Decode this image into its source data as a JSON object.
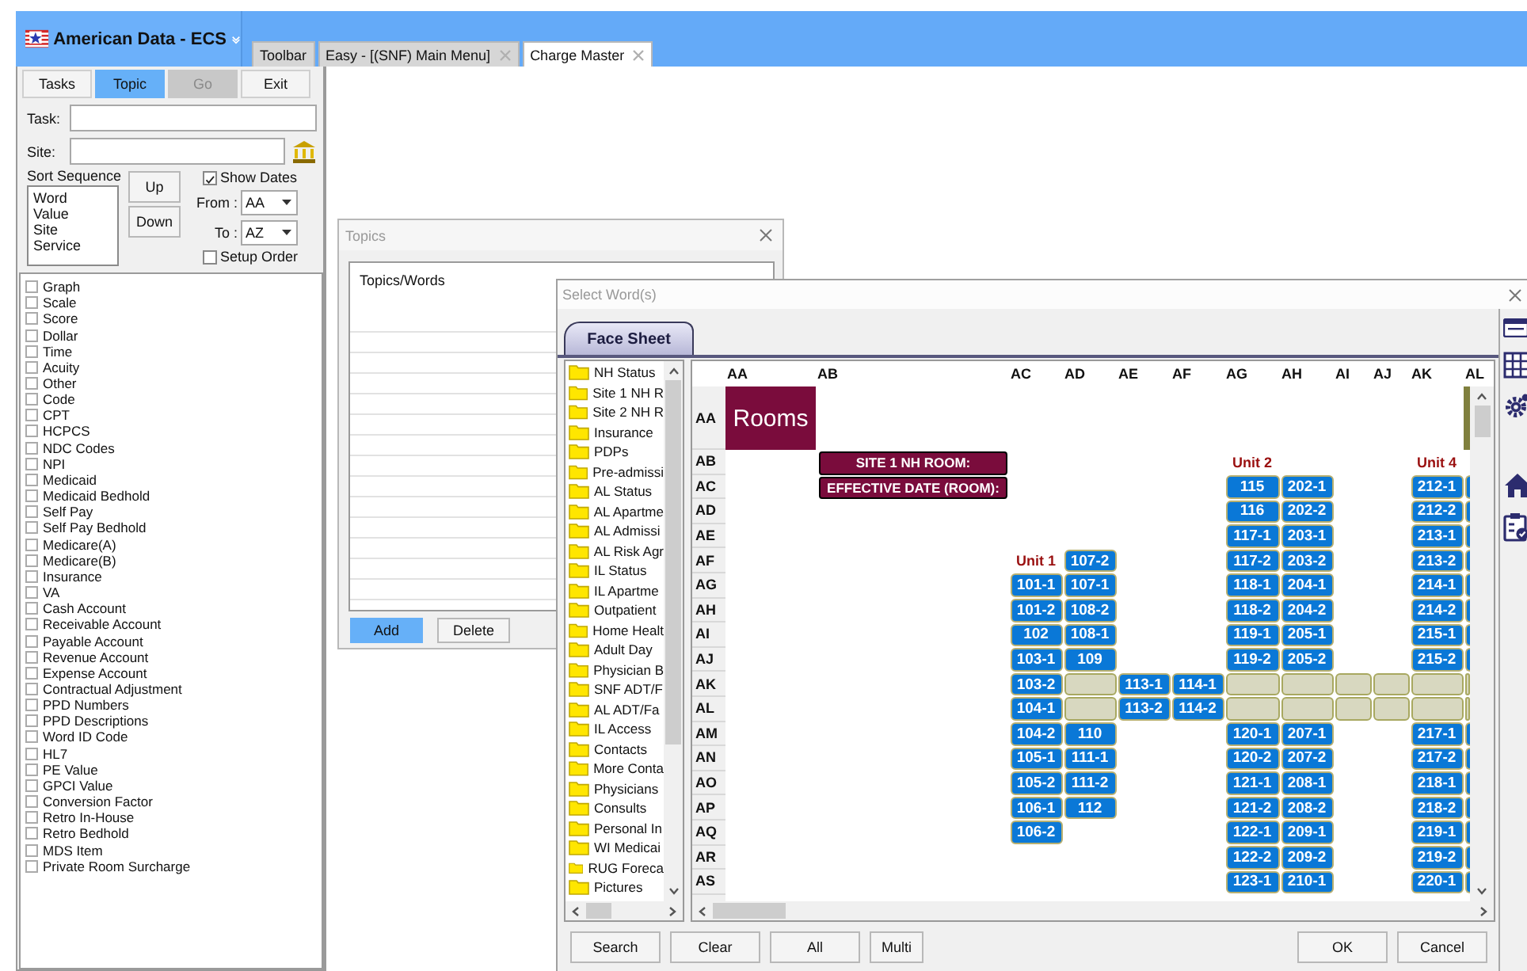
{
  "app": {
    "title": "American Data - ECS"
  },
  "tabs": [
    {
      "label": "Toolbar",
      "selected": false,
      "closable": false
    },
    {
      "label": "Easy - [(SNF) Main Menu]",
      "selected": false,
      "closable": true
    },
    {
      "label": "Charge Master",
      "selected": true,
      "closable": true
    }
  ],
  "side_panel": {
    "buttons": [
      {
        "label": "Tasks",
        "selected": false,
        "disabled": false
      },
      {
        "label": "Topic",
        "selected": true,
        "disabled": false
      },
      {
        "label": "Go",
        "selected": false,
        "disabled": true
      },
      {
        "label": "Exit",
        "selected": false,
        "disabled": false
      }
    ],
    "task": {
      "label": "Task:"
    },
    "site": {
      "label": "Site:"
    },
    "sort_sequence": {
      "label": "Sort Sequence",
      "items": [
        "Word",
        "Value",
        "Site",
        "Service"
      ]
    },
    "up_button": "Up",
    "down_button": "Down",
    "show_dates": {
      "label": "Show Dates",
      "checked": true
    },
    "from": {
      "label": "From :",
      "value": "AA"
    },
    "to": {
      "label": "To :",
      "value": "AZ"
    },
    "setup_order": {
      "label": "Setup Order",
      "checked": false
    },
    "categories": [
      {
        "label": "Graph",
        "checked": false
      },
      {
        "label": "Scale",
        "checked": false
      },
      {
        "label": "Score",
        "checked": false
      },
      {
        "label": "Dollar",
        "checked": false
      },
      {
        "label": "Time",
        "checked": false
      },
      {
        "label": "Acuity",
        "checked": false
      },
      {
        "label": "Other",
        "checked": false
      },
      {
        "label": "Code",
        "checked": false
      },
      {
        "label": "CPT",
        "checked": false
      },
      {
        "label": "HCPCS",
        "checked": false
      },
      {
        "label": "NDC Codes",
        "checked": false
      },
      {
        "label": "NPI",
        "checked": false
      },
      {
        "label": "Medicaid",
        "checked": false
      },
      {
        "label": "Medicaid Bedhold",
        "checked": false
      },
      {
        "label": "Self Pay",
        "checked": false
      },
      {
        "label": "Self Pay Bedhold",
        "checked": false
      },
      {
        "label": "Medicare(A)",
        "checked": false
      },
      {
        "label": "Medicare(B)",
        "checked": false
      },
      {
        "label": "Insurance",
        "checked": false
      },
      {
        "label": "VA",
        "checked": false
      },
      {
        "label": "Cash Account",
        "checked": false
      },
      {
        "label": "Receivable Account",
        "checked": false
      },
      {
        "label": "Payable Account",
        "checked": false
      },
      {
        "label": "Revenue Account",
        "checked": false
      },
      {
        "label": "Expense Account",
        "checked": false
      },
      {
        "label": "Contractual Adjustment",
        "checked": false
      },
      {
        "label": "PPD Numbers",
        "checked": false
      },
      {
        "label": "PPD Descriptions",
        "checked": false
      },
      {
        "label": "Word ID Code",
        "checked": false
      },
      {
        "label": "HL7",
        "checked": false
      },
      {
        "label": "PE Value",
        "checked": false
      },
      {
        "label": "GPCI Value",
        "checked": false
      },
      {
        "label": "Conversion Factor",
        "checked": false
      },
      {
        "label": "Retro In-House",
        "checked": false
      },
      {
        "label": "Retro Bedhold",
        "checked": false
      },
      {
        "label": "MDS Item",
        "checked": false
      },
      {
        "label": "Private Room Surcharge",
        "checked": false
      }
    ]
  },
  "topics_dialog": {
    "title": "Topics",
    "column": "Topics/Words",
    "buttons": [
      {
        "label": "Add",
        "selected": true
      },
      {
        "label": "Delete",
        "selected": false
      }
    ]
  },
  "select_words": {
    "title": "Select Word(s)",
    "tabs": [
      {
        "label": "Face Sheet",
        "selected": true
      }
    ],
    "folders": [
      "NH Status",
      "Site 1 NH R",
      "Site 2 NH R",
      "Insurance",
      "PDPs",
      "Pre-admissi",
      "AL Status",
      "AL Apartme",
      "AL Admissi",
      "AL Risk Agr",
      "IL Status",
      "IL Apartme",
      "Outpatient",
      "Home Healt",
      "Adult Day",
      "Physician B",
      "SNF ADT/F",
      "AL ADT/Fa",
      "IL Access",
      "Contacts",
      "More Conta",
      "Physicians",
      "Consults",
      "Personal In",
      "WI Medicai",
      "RUG Foreca",
      "Pictures"
    ],
    "grid": {
      "columns": [
        "AA",
        "AB",
        "AC",
        "AD",
        "AE",
        "AF",
        "AG",
        "AH",
        "AI",
        "AJ",
        "AK",
        "AL"
      ],
      "rows": [
        {
          "label": "AA",
          "cells": [
            {
              "kind": "title",
              "text": "Rooms"
            },
            {
              "kind": "banner"
            }
          ]
        },
        {
          "label": "AB",
          "cells": [
            {
              "kind": "empty"
            },
            {
              "kind": "field",
              "text": "SITE 1 NH ROOM:"
            },
            {
              "kind": "empty"
            },
            {
              "kind": "empty"
            },
            {
              "kind": "empty"
            },
            {
              "kind": "empty"
            },
            {
              "kind": "unit",
              "text": "Unit 2"
            },
            {
              "kind": "empty"
            },
            {
              "kind": "empty"
            },
            {
              "kind": "empty"
            },
            {
              "kind": "unit",
              "text": "Unit 4"
            }
          ]
        },
        {
          "label": "AC",
          "cells": [
            {
              "kind": "empty"
            },
            {
              "kind": "field",
              "text": "EFFECTIVE DATE (ROOM):"
            },
            {
              "kind": "empty"
            },
            {
              "kind": "empty"
            },
            {
              "kind": "empty"
            },
            {
              "kind": "empty"
            },
            {
              "kind": "room",
              "text": "115"
            },
            {
              "kind": "room",
              "text": "202-1"
            },
            {
              "kind": "empty"
            },
            {
              "kind": "empty"
            },
            {
              "kind": "room",
              "text": "212-1"
            },
            {
              "kind": "edge"
            }
          ]
        },
        {
          "label": "AD",
          "cells": [
            {
              "kind": "empty"
            },
            {
              "kind": "empty"
            },
            {
              "kind": "empty"
            },
            {
              "kind": "empty"
            },
            {
              "kind": "empty"
            },
            {
              "kind": "empty"
            },
            {
              "kind": "room",
              "text": "116"
            },
            {
              "kind": "room",
              "text": "202-2"
            },
            {
              "kind": "empty"
            },
            {
              "kind": "empty"
            },
            {
              "kind": "room",
              "text": "212-2"
            },
            {
              "kind": "edge"
            }
          ]
        },
        {
          "label": "AE",
          "cells": [
            {
              "kind": "empty"
            },
            {
              "kind": "empty"
            },
            {
              "kind": "empty"
            },
            {
              "kind": "empty"
            },
            {
              "kind": "empty"
            },
            {
              "kind": "empty"
            },
            {
              "kind": "room",
              "text": "117-1"
            },
            {
              "kind": "room",
              "text": "203-1"
            },
            {
              "kind": "empty"
            },
            {
              "kind": "empty"
            },
            {
              "kind": "room",
              "text": "213-1"
            },
            {
              "kind": "edge"
            }
          ]
        },
        {
          "label": "AF",
          "cells": [
            {
              "kind": "empty"
            },
            {
              "kind": "empty"
            },
            {
              "kind": "unit",
              "text": "Unit 1"
            },
            {
              "kind": "room",
              "text": "107-2"
            },
            {
              "kind": "empty"
            },
            {
              "kind": "empty"
            },
            {
              "kind": "room",
              "text": "117-2"
            },
            {
              "kind": "room",
              "text": "203-2"
            },
            {
              "kind": "empty"
            },
            {
              "kind": "empty"
            },
            {
              "kind": "room",
              "text": "213-2"
            },
            {
              "kind": "edge"
            }
          ]
        },
        {
          "label": "AG",
          "cells": [
            {
              "kind": "empty"
            },
            {
              "kind": "empty"
            },
            {
              "kind": "room",
              "text": "101-1"
            },
            {
              "kind": "room",
              "text": "107-1"
            },
            {
              "kind": "empty"
            },
            {
              "kind": "empty"
            },
            {
              "kind": "room",
              "text": "118-1"
            },
            {
              "kind": "room",
              "text": "204-1"
            },
            {
              "kind": "empty"
            },
            {
              "kind": "empty"
            },
            {
              "kind": "room",
              "text": "214-1"
            },
            {
              "kind": "edge"
            }
          ]
        },
        {
          "label": "AH",
          "cells": [
            {
              "kind": "empty"
            },
            {
              "kind": "empty"
            },
            {
              "kind": "room",
              "text": "101-2"
            },
            {
              "kind": "room",
              "text": "108-2"
            },
            {
              "kind": "empty"
            },
            {
              "kind": "empty"
            },
            {
              "kind": "room",
              "text": "118-2"
            },
            {
              "kind": "room",
              "text": "204-2"
            },
            {
              "kind": "empty"
            },
            {
              "kind": "empty"
            },
            {
              "kind": "room",
              "text": "214-2"
            },
            {
              "kind": "edge"
            }
          ]
        },
        {
          "label": "AI",
          "cells": [
            {
              "kind": "empty"
            },
            {
              "kind": "empty"
            },
            {
              "kind": "room",
              "text": "102"
            },
            {
              "kind": "room",
              "text": "108-1"
            },
            {
              "kind": "empty"
            },
            {
              "kind": "empty"
            },
            {
              "kind": "room",
              "text": "119-1"
            },
            {
              "kind": "room",
              "text": "205-1"
            },
            {
              "kind": "empty"
            },
            {
              "kind": "empty"
            },
            {
              "kind": "room",
              "text": "215-1"
            },
            {
              "kind": "edge"
            }
          ]
        },
        {
          "label": "AJ",
          "cells": [
            {
              "kind": "empty"
            },
            {
              "kind": "empty"
            },
            {
              "kind": "room",
              "text": "103-1"
            },
            {
              "kind": "room",
              "text": "109"
            },
            {
              "kind": "empty"
            },
            {
              "kind": "empty"
            },
            {
              "kind": "room",
              "text": "119-2"
            },
            {
              "kind": "room",
              "text": "205-2"
            },
            {
              "kind": "empty"
            },
            {
              "kind": "empty"
            },
            {
              "kind": "room",
              "text": "215-2"
            },
            {
              "kind": "edge"
            }
          ]
        },
        {
          "label": "AK",
          "cells": [
            {
              "kind": "empty"
            },
            {
              "kind": "empty"
            },
            {
              "kind": "room",
              "text": "103-2"
            },
            {
              "kind": "corridor"
            },
            {
              "kind": "room",
              "text": "113-1"
            },
            {
              "kind": "room",
              "text": "114-1"
            },
            {
              "kind": "corridor"
            },
            {
              "kind": "corridor"
            },
            {
              "kind": "corridor"
            },
            {
              "kind": "corridor"
            },
            {
              "kind": "corridor"
            },
            {
              "kind": "corridor"
            }
          ]
        },
        {
          "label": "AL",
          "cells": [
            {
              "kind": "empty"
            },
            {
              "kind": "empty"
            },
            {
              "kind": "room",
              "text": "104-1"
            },
            {
              "kind": "corridor"
            },
            {
              "kind": "room",
              "text": "113-2"
            },
            {
              "kind": "room",
              "text": "114-2"
            },
            {
              "kind": "corridor"
            },
            {
              "kind": "corridor"
            },
            {
              "kind": "corridor"
            },
            {
              "kind": "corridor"
            },
            {
              "kind": "corridor"
            },
            {
              "kind": "corridor"
            }
          ]
        },
        {
          "label": "AM",
          "cells": [
            {
              "kind": "empty"
            },
            {
              "kind": "empty"
            },
            {
              "kind": "room",
              "text": "104-2"
            },
            {
              "kind": "room",
              "text": "110"
            },
            {
              "kind": "empty"
            },
            {
              "kind": "empty"
            },
            {
              "kind": "room",
              "text": "120-1"
            },
            {
              "kind": "room",
              "text": "207-1"
            },
            {
              "kind": "empty"
            },
            {
              "kind": "empty"
            },
            {
              "kind": "room",
              "text": "217-1"
            },
            {
              "kind": "edge"
            }
          ]
        },
        {
          "label": "AN",
          "cells": [
            {
              "kind": "empty"
            },
            {
              "kind": "empty"
            },
            {
              "kind": "room",
              "text": "105-1"
            },
            {
              "kind": "room",
              "text": "111-1"
            },
            {
              "kind": "empty"
            },
            {
              "kind": "empty"
            },
            {
              "kind": "room",
              "text": "120-2"
            },
            {
              "kind": "room",
              "text": "207-2"
            },
            {
              "kind": "empty"
            },
            {
              "kind": "empty"
            },
            {
              "kind": "room",
              "text": "217-2"
            },
            {
              "kind": "edge"
            }
          ]
        },
        {
          "label": "AO",
          "cells": [
            {
              "kind": "empty"
            },
            {
              "kind": "empty"
            },
            {
              "kind": "room",
              "text": "105-2"
            },
            {
              "kind": "room",
              "text": "111-2"
            },
            {
              "kind": "empty"
            },
            {
              "kind": "empty"
            },
            {
              "kind": "room",
              "text": "121-1"
            },
            {
              "kind": "room",
              "text": "208-1"
            },
            {
              "kind": "empty"
            },
            {
              "kind": "empty"
            },
            {
              "kind": "room",
              "text": "218-1"
            },
            {
              "kind": "edge"
            }
          ]
        },
        {
          "label": "AP",
          "cells": [
            {
              "kind": "empty"
            },
            {
              "kind": "empty"
            },
            {
              "kind": "room",
              "text": "106-1"
            },
            {
              "kind": "room",
              "text": "112"
            },
            {
              "kind": "empty"
            },
            {
              "kind": "empty"
            },
            {
              "kind": "room",
              "text": "121-2"
            },
            {
              "kind": "room",
              "text": "208-2"
            },
            {
              "kind": "empty"
            },
            {
              "kind": "empty"
            },
            {
              "kind": "room",
              "text": "218-2"
            },
            {
              "kind": "edge"
            }
          ]
        },
        {
          "label": "AQ",
          "cells": [
            {
              "kind": "empty"
            },
            {
              "kind": "empty"
            },
            {
              "kind": "room",
              "text": "106-2"
            },
            {
              "kind": "empty"
            },
            {
              "kind": "empty"
            },
            {
              "kind": "empty"
            },
            {
              "kind": "room",
              "text": "122-1"
            },
            {
              "kind": "room",
              "text": "209-1"
            },
            {
              "kind": "empty"
            },
            {
              "kind": "empty"
            },
            {
              "kind": "room",
              "text": "219-1"
            },
            {
              "kind": "edge"
            }
          ]
        },
        {
          "label": "AR",
          "cells": [
            {
              "kind": "empty"
            },
            {
              "kind": "empty"
            },
            {
              "kind": "empty"
            },
            {
              "kind": "empty"
            },
            {
              "kind": "empty"
            },
            {
              "kind": "empty"
            },
            {
              "kind": "room",
              "text": "122-2"
            },
            {
              "kind": "room",
              "text": "209-2"
            },
            {
              "kind": "empty"
            },
            {
              "kind": "empty"
            },
            {
              "kind": "room",
              "text": "219-2"
            },
            {
              "kind": "edge"
            }
          ]
        },
        {
          "label": "AS",
          "cells": [
            {
              "kind": "empty"
            },
            {
              "kind": "empty"
            },
            {
              "kind": "empty"
            },
            {
              "kind": "empty"
            },
            {
              "kind": "empty"
            },
            {
              "kind": "empty"
            },
            {
              "kind": "room",
              "text": "123-1"
            },
            {
              "kind": "room",
              "text": "210-1"
            },
            {
              "kind": "empty"
            },
            {
              "kind": "empty"
            },
            {
              "kind": "room",
              "text": "220-1"
            },
            {
              "kind": "edge"
            }
          ]
        }
      ]
    },
    "left_buttons": [
      "Search",
      "Clear",
      "All",
      "Multi"
    ],
    "right_buttons": [
      "OK",
      "Cancel"
    ]
  }
}
